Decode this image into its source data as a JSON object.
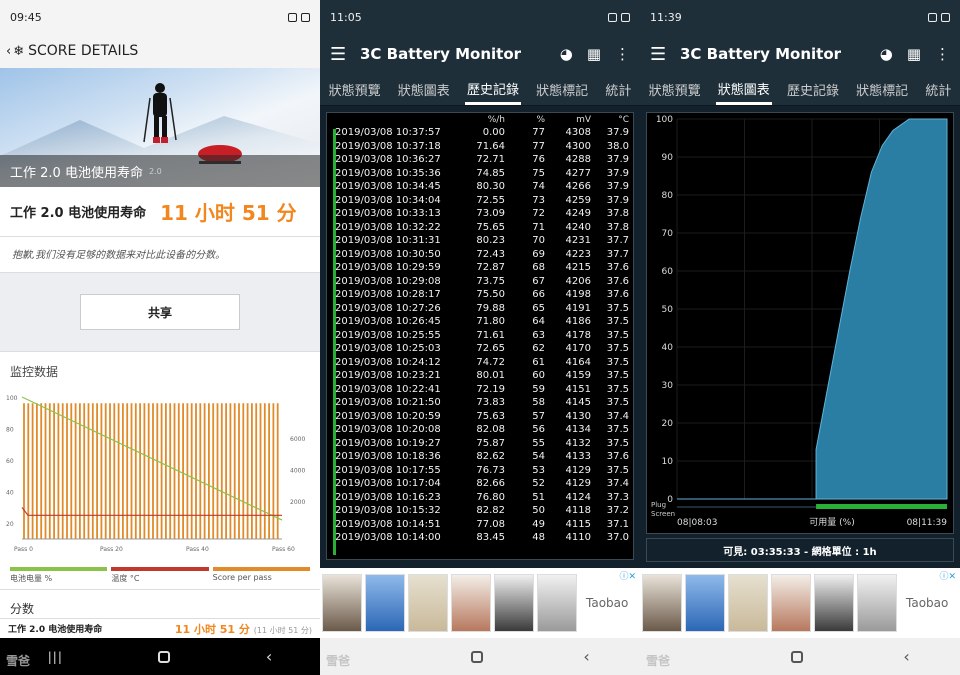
{
  "phone1": {
    "status": {
      "time": "09:45",
      "icons": "…"
    },
    "header": {
      "title": "SCORE DETAILS"
    },
    "hero": {
      "caption": "工作 2.0 电池使用寿命",
      "caption_small": "2.0"
    },
    "score": {
      "label": "工作 2.0 电池使用寿命",
      "value": "11 小时 51 分"
    },
    "sorry": "抱歉,我们没有足够的数据来对比此设备的分数。",
    "share_label": "共享",
    "monitor_title": "监控数据",
    "chart": {
      "y_left_ticks": [
        "100",
        "80",
        "60",
        "40",
        "20"
      ],
      "y_right_ticks": [
        "6000",
        "4000",
        "2000"
      ],
      "x_ticks": [
        "Pass 0",
        "Pass 20",
        "Pass 40",
        "Pass 60"
      ]
    },
    "legend": [
      {
        "label": "电池电量 %",
        "color": "#8bc34a"
      },
      {
        "label": "温度 °C",
        "color": "#c0392b"
      },
      {
        "label": "Score per pass",
        "color": "#e08a2a"
      }
    ],
    "section_fen": "分数",
    "bottom": {
      "label": "工作 2.0 电池使用寿命",
      "value": "11 小时 51 分",
      "note": "(11 小时 51 分)"
    },
    "watermark": "雪爸"
  },
  "app": {
    "title": "3C Battery Monitor",
    "tabs": [
      "狀態預覽",
      "狀態圖表",
      "歷史記錄",
      "狀態標記",
      "統計"
    ]
  },
  "phone2": {
    "status": {
      "time": "11:05"
    },
    "active_tab": 2,
    "table": {
      "headers": [
        "%/h",
        "%",
        "mV",
        "°C"
      ],
      "rows": [
        [
          "2019/03/08  10:37:57",
          "0.00",
          "77",
          "4308",
          "37.9"
        ],
        [
          "2019/03/08  10:37:18",
          "71.64",
          "77",
          "4300",
          "38.0"
        ],
        [
          "2019/03/08  10:36:27",
          "72.71",
          "76",
          "4288",
          "37.9"
        ],
        [
          "2019/03/08  10:35:36",
          "74.85",
          "75",
          "4277",
          "37.9"
        ],
        [
          "2019/03/08  10:34:45",
          "80.30",
          "74",
          "4266",
          "37.9"
        ],
        [
          "2019/03/08  10:34:04",
          "72.55",
          "73",
          "4259",
          "37.9"
        ],
        [
          "2019/03/08  10:33:13",
          "73.09",
          "72",
          "4249",
          "37.8"
        ],
        [
          "2019/03/08  10:32:22",
          "75.65",
          "71",
          "4240",
          "37.8"
        ],
        [
          "2019/03/08  10:31:31",
          "80.23",
          "70",
          "4231",
          "37.7"
        ],
        [
          "2019/03/08  10:30:50",
          "72.43",
          "69",
          "4223",
          "37.7"
        ],
        [
          "2019/03/08  10:29:59",
          "72.87",
          "68",
          "4215",
          "37.6"
        ],
        [
          "2019/03/08  10:29:08",
          "73.75",
          "67",
          "4206",
          "37.6"
        ],
        [
          "2019/03/08  10:28:17",
          "75.50",
          "66",
          "4198",
          "37.6"
        ],
        [
          "2019/03/08  10:27:26",
          "79.88",
          "65",
          "4191",
          "37.5"
        ],
        [
          "2019/03/08  10:26:45",
          "71.80",
          "64",
          "4186",
          "37.5"
        ],
        [
          "2019/03/08  10:25:55",
          "71.61",
          "63",
          "4178",
          "37.5"
        ],
        [
          "2019/03/08  10:25:03",
          "72.65",
          "62",
          "4170",
          "37.5"
        ],
        [
          "2019/03/08  10:24:12",
          "74.72",
          "61",
          "4164",
          "37.5"
        ],
        [
          "2019/03/08  10:23:21",
          "80.01",
          "60",
          "4159",
          "37.5"
        ],
        [
          "2019/03/08  10:22:41",
          "72.19",
          "59",
          "4151",
          "37.5"
        ],
        [
          "2019/03/08  10:21:50",
          "73.83",
          "58",
          "4145",
          "37.5"
        ],
        [
          "2019/03/08  10:20:59",
          "75.63",
          "57",
          "4130",
          "37.4"
        ],
        [
          "2019/03/08  10:20:08",
          "82.08",
          "56",
          "4134",
          "37.5"
        ],
        [
          "2019/03/08  10:19:27",
          "75.87",
          "55",
          "4132",
          "37.5"
        ],
        [
          "2019/03/08  10:18:36",
          "82.62",
          "54",
          "4133",
          "37.6"
        ],
        [
          "2019/03/08  10:17:55",
          "76.73",
          "53",
          "4129",
          "37.5"
        ],
        [
          "2019/03/08  10:17:04",
          "82.66",
          "52",
          "4129",
          "37.4"
        ],
        [
          "2019/03/08  10:16:23",
          "76.80",
          "51",
          "4124",
          "37.3"
        ],
        [
          "2019/03/08  10:15:32",
          "82.82",
          "50",
          "4118",
          "37.2"
        ],
        [
          "2019/03/08  10:14:51",
          "77.08",
          "49",
          "4115",
          "37.1"
        ],
        [
          "2019/03/08  10:14:00",
          "83.45",
          "48",
          "4110",
          "37.0"
        ]
      ]
    }
  },
  "ad": {
    "brand": "Taobao",
    "choice": "ⓘ✕"
  },
  "phone3": {
    "status": {
      "time": "11:39"
    },
    "active_tab": 1,
    "footer": "可見: 03:35:33 - 網格單位 : 1h"
  },
  "chart_data": {
    "type": "area",
    "x_labels": [
      "08|08:03",
      "08|11:39"
    ],
    "xlabel": "可用量 (%)",
    "ylim": [
      0,
      100
    ],
    "y_ticks": [
      0,
      10,
      20,
      30,
      40,
      50,
      60,
      70,
      80,
      90,
      100
    ],
    "side_labels": [
      "Plug",
      "Screen"
    ],
    "series": [
      {
        "values": [
          [
            0,
            0
          ],
          [
            0.515,
            0
          ],
          [
            0.515,
            13
          ],
          [
            0.56,
            30
          ],
          [
            0.6,
            45
          ],
          [
            0.64,
            60
          ],
          [
            0.68,
            74
          ],
          [
            0.72,
            86
          ],
          [
            0.76,
            93
          ],
          [
            0.8,
            97
          ],
          [
            0.84,
            99
          ],
          [
            0.86,
            100
          ],
          [
            1.0,
            100
          ]
        ]
      }
    ],
    "colors": {
      "fill": "#2b7ea3",
      "plug_bar": "#2ab036"
    }
  }
}
